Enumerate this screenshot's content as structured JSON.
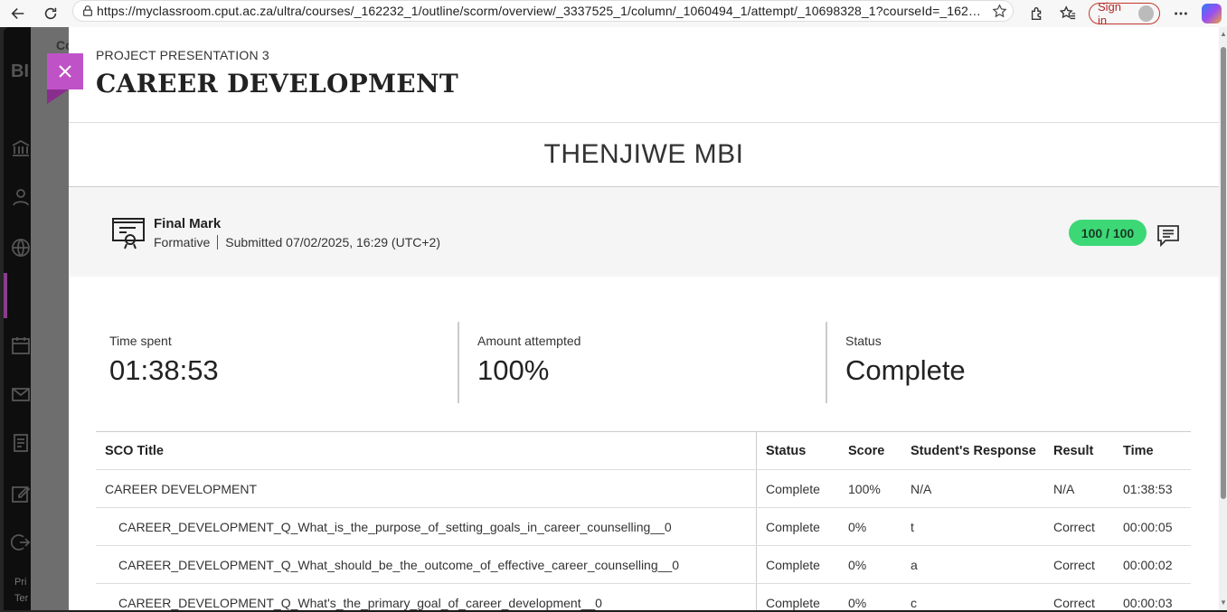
{
  "browser": {
    "url": "https://myclassroom.cput.ac.za/ultra/courses/_162232_1/outline/scorm/overview/_3337525_1/column/_1060494_1/attempt/_10698328_1?courseId=_16223...",
    "signin_label": "Sign in"
  },
  "background": {
    "fragment_co": "Co",
    "fragment_bi": "BI",
    "fragment_pri": "Pri",
    "fragment_ter": "Ter"
  },
  "panel": {
    "kicker": "PROJECT PRESENTATION 3",
    "title": "CAREER DEVELOPMENT",
    "student_name": "THENJIWE MBI",
    "final_mark": {
      "label": "Final Mark",
      "type": "Formative",
      "submitted": "Submitted 07/02/2025, 16:29 (UTC+2)",
      "score": "100 / 100"
    },
    "stats": [
      {
        "label": "Time spent",
        "value": "01:38:53"
      },
      {
        "label": "Amount attempted",
        "value": "100%"
      },
      {
        "label": "Status",
        "value": "Complete"
      }
    ],
    "table": {
      "headers": [
        "SCO Title",
        "Status",
        "Score",
        "Student's Response",
        "Result",
        "Time"
      ],
      "rows": [
        [
          "CAREER DEVELOPMENT",
          "Complete",
          "100%",
          "N/A",
          "N/A",
          "01:38:53"
        ],
        [
          "CAREER_DEVELOPMENT_Q_What_is_the_purpose_of_setting_goals_in_career_counselling__0",
          "Complete",
          "0%",
          "t",
          "Correct",
          "00:00:05"
        ],
        [
          "CAREER_DEVELOPMENT_Q_What_should_be_the_outcome_of_effective_career_counselling__0",
          "Complete",
          "0%",
          "a",
          "Correct",
          "00:00:02"
        ],
        [
          "CAREER_DEVELOPMENT_Q_What's_the_primary_goal_of_career_development__0",
          "Complete",
          "0%",
          "c",
          "Correct",
          "00:00:03"
        ]
      ]
    }
  },
  "colors": {
    "close_button": "#c052c7",
    "score_pill": "#3dd876"
  }
}
